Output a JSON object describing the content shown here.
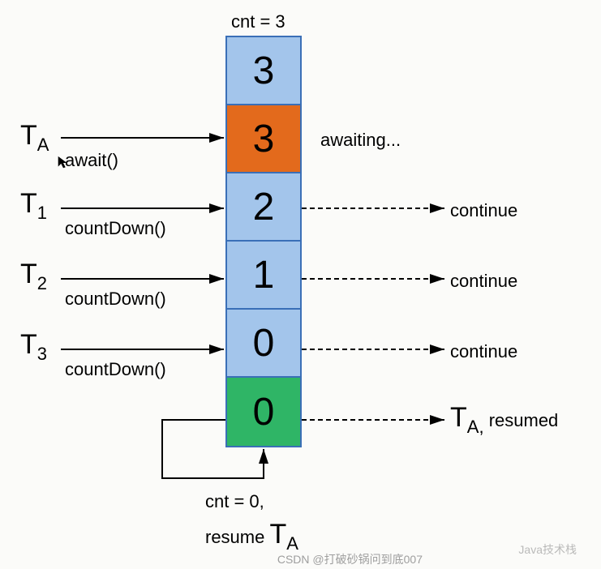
{
  "top_label": "cnt = 3",
  "cells": [
    {
      "value": "3",
      "color": "blue"
    },
    {
      "value": "3",
      "color": "orange"
    },
    {
      "value": "2",
      "color": "blue"
    },
    {
      "value": "1",
      "color": "blue"
    },
    {
      "value": "0",
      "color": "blue"
    },
    {
      "value": "0",
      "color": "green"
    }
  ],
  "threads": {
    "ta": {
      "prefix": "T",
      "sub": "A",
      "method": "await()"
    },
    "t1": {
      "prefix": "T",
      "sub": "1",
      "method": "countDown()"
    },
    "t2": {
      "prefix": "T",
      "sub": "2",
      "method": "countDown()"
    },
    "t3": {
      "prefix": "T",
      "sub": "3",
      "method": "countDown()"
    }
  },
  "right": {
    "awaiting": "awaiting...",
    "c1": "continue",
    "c2": "continue",
    "c3": "continue",
    "resumed_prefix": "T",
    "resumed_sub": "A,",
    "resumed_text": " resumed"
  },
  "bottom": {
    "line1": "cnt = 0,",
    "line2_prefix": "resume ",
    "line2_t": "T",
    "line2_sub": "A"
  },
  "watermark1": "Java技术栈",
  "watermark2": "CSDN @打破砂锅问到底007"
}
